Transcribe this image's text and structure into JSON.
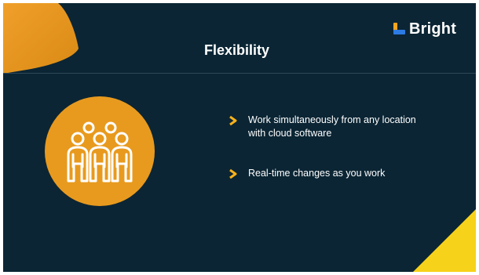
{
  "slide": {
    "title": "Flexibility",
    "logo_text": "Bright",
    "icon": "people-group-icon",
    "bullets": [
      "Work simultaneously from any location with cloud software",
      "Real-time changes as you work"
    ],
    "colors": {
      "background": "#0b2534",
      "accent_orange": "#e89a1e",
      "accent_yellow": "#f7d21a",
      "logo_blue": "#2c7be5",
      "text": "#ffffff"
    }
  }
}
